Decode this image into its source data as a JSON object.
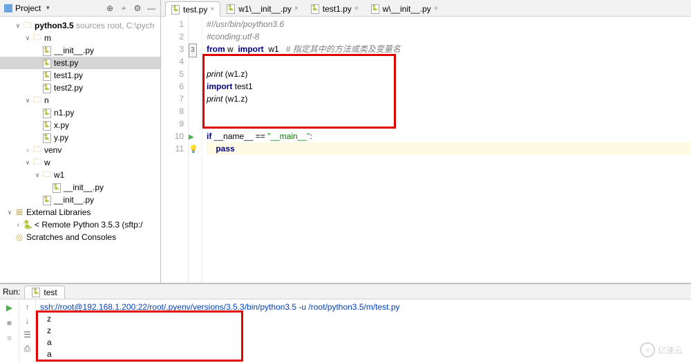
{
  "project_panel": {
    "title": "Project",
    "root": {
      "name": "python3.5",
      "path_suffix": "sources root, C:\\pych"
    },
    "tree": [
      {
        "name": "m",
        "type": "folder",
        "expanded": true,
        "indent": 2,
        "children": [
          {
            "name": "__init__.py",
            "type": "py",
            "indent": 3
          },
          {
            "name": "test.py",
            "type": "py",
            "indent": 3,
            "selected": true
          },
          {
            "name": "test1.py",
            "type": "py",
            "indent": 3
          },
          {
            "name": "test2.py",
            "type": "py",
            "indent": 3
          }
        ]
      },
      {
        "name": "n",
        "type": "folder",
        "expanded": true,
        "indent": 2,
        "children": [
          {
            "name": "n1.py",
            "type": "py",
            "indent": 3
          },
          {
            "name": "x.py",
            "type": "py",
            "indent": 3
          },
          {
            "name": "y.py",
            "type": "py",
            "indent": 3
          }
        ]
      },
      {
        "name": "venv",
        "type": "folder",
        "expanded": false,
        "indent": 2
      },
      {
        "name": "w",
        "type": "folder",
        "expanded": true,
        "indent": 2,
        "children": [
          {
            "name": "w1",
            "type": "folder",
            "expanded": true,
            "indent": 3,
            "children": [
              {
                "name": "__init__.py",
                "type": "py",
                "indent": 4
              }
            ]
          },
          {
            "name": "__init__.py",
            "type": "py",
            "indent": 3
          }
        ]
      }
    ],
    "external_libs": "External Libraries",
    "remote": "< Remote Python 3.5.3 (sftp:/",
    "scratches": "Scratches and Consoles"
  },
  "tabs": [
    {
      "name": "test.py",
      "active": true
    },
    {
      "name": "w1\\__init__.py",
      "active": false
    },
    {
      "name": "test1.py",
      "active": false
    },
    {
      "name": "w\\__init__.py",
      "active": false
    }
  ],
  "code": {
    "lines": [
      {
        "n": 1,
        "segments": [
          {
            "t": "#!/usr/bin/poython3.6",
            "cls": "cm"
          }
        ]
      },
      {
        "n": 2,
        "segments": [
          {
            "t": "#conding:utf-8",
            "cls": "cm"
          }
        ]
      },
      {
        "n": 3,
        "marker": "3",
        "segments": [
          {
            "t": "from",
            "cls": "kw"
          },
          {
            "t": " w  "
          },
          {
            "t": "import",
            "cls": "kw"
          },
          {
            "t": "  w1   "
          },
          {
            "t": "# 指定其中的方法或类及变量名",
            "cls": "cm"
          }
        ]
      },
      {
        "n": 4,
        "segments": [
          {
            "t": ""
          }
        ]
      },
      {
        "n": 5,
        "segments": [
          {
            "t": "print",
            "cls": "fn"
          },
          {
            "t": " (w1.z)"
          }
        ]
      },
      {
        "n": 6,
        "segments": [
          {
            "t": "import",
            "cls": "kw"
          },
          {
            "t": " test1"
          }
        ]
      },
      {
        "n": 7,
        "segments": [
          {
            "t": "print",
            "cls": "fn"
          },
          {
            "t": " (w1.z)"
          }
        ]
      },
      {
        "n": 8,
        "segments": [
          {
            "t": ""
          }
        ]
      },
      {
        "n": 9,
        "segments": [
          {
            "t": ""
          }
        ]
      },
      {
        "n": 10,
        "gutter": "play",
        "segments": [
          {
            "t": "if",
            "cls": "kw"
          },
          {
            "t": " __name__ == "
          },
          {
            "t": "\"__main__\"",
            "cls": "str"
          },
          {
            "t": ":"
          }
        ]
      },
      {
        "n": 11,
        "gutter": "bulb",
        "hl": true,
        "segments": [
          {
            "t": "    "
          },
          {
            "t": "pass",
            "cls": "kw"
          }
        ]
      }
    ]
  },
  "run": {
    "label": "Run:",
    "config_name": "test",
    "command": "ssh://root@192.168.1.200:22/root/.pyenv/versions/3.5.3/bin/python3.5 -u /root/python3.5/m/test.py",
    "output": [
      "z",
      "z",
      "a",
      "a"
    ]
  },
  "watermark": "亿速云"
}
